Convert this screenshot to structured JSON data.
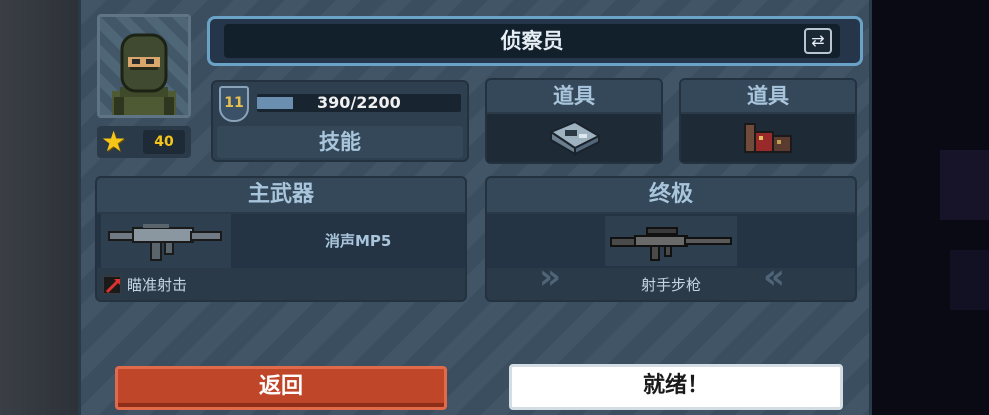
{
  "character": {
    "class_name": "侦察员",
    "stars": "40"
  },
  "level": {
    "number": "11",
    "xp_text": "390/2200",
    "xp_fraction": 0.177,
    "skill_label": "技能"
  },
  "items": [
    {
      "label": "道具",
      "icon": "sensor-device-icon"
    },
    {
      "label": "道具",
      "icon": "ammo-explosive-icon"
    }
  ],
  "primary_weapon": {
    "title": "主武器",
    "name": "消声MP5",
    "perk": "瞄准射击",
    "icon": "smg-icon"
  },
  "ultimate": {
    "title": "终极",
    "name": "射手步枪",
    "icon": "rifle-icon"
  },
  "buttons": {
    "back": "返回",
    "ready": "就绪！"
  },
  "colors": {
    "back_button": "#c0462a",
    "ready_button": "#ffffff",
    "panel": "#3d5163",
    "accent": "#6aa3c7"
  }
}
